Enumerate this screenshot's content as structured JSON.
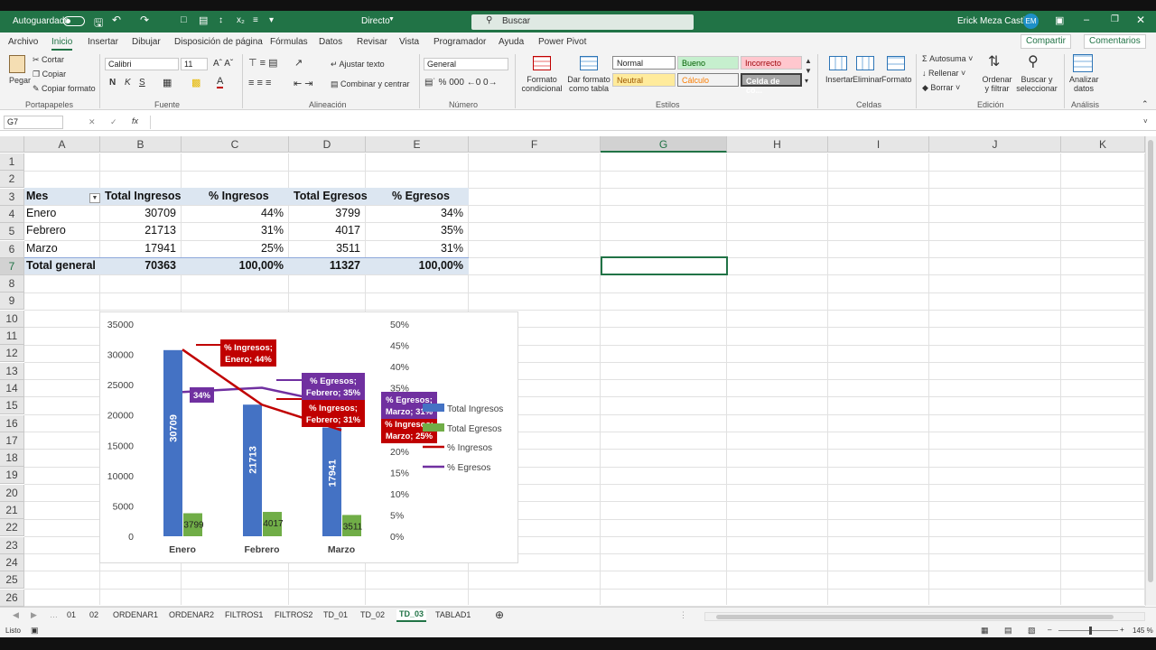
{
  "titlebar": {
    "autosave_label": "Autoguardado",
    "doc_title": "Directo",
    "search_placeholder": "Buscar",
    "user_name": "Erick Meza Castillo",
    "user_initials": "EM"
  },
  "menu": {
    "items": [
      "Archivo",
      "Inicio",
      "Insertar",
      "Dibujar",
      "Disposición de página",
      "Fórmulas",
      "Datos",
      "Revisar",
      "Vista",
      "Programador",
      "Ayuda",
      "Power Pivot"
    ],
    "share_label": "Compartir",
    "comments_label": "Comentarios"
  },
  "ribbon": {
    "clipboard": {
      "paste": "Pegar",
      "cut": "Cortar",
      "copy": "Copiar",
      "format_painter": "Copiar formato",
      "group": "Portapapeles"
    },
    "font": {
      "family": "Calibri",
      "size": "11",
      "bold": "N",
      "italic": "K",
      "underline": "S",
      "group": "Fuente"
    },
    "alignment": {
      "wrap": "Ajustar texto",
      "merge": "Combinar y centrar",
      "group": "Alineación"
    },
    "number": {
      "format": "General",
      "group": "Número"
    },
    "styles": {
      "cond_format": "Formato condicional",
      "table_format": "Dar formato como tabla",
      "normal": "Normal",
      "good": "Bueno",
      "bad": "Incorrecto",
      "neutral": "Neutral",
      "calc": "Cálculo",
      "check": "Celda de co...",
      "group": "Estilos"
    },
    "cells": {
      "insert": "Insertar",
      "delete": "Eliminar",
      "format": "Formato",
      "group": "Celdas"
    },
    "editing": {
      "autosum": "Autosuma",
      "fill": "Rellenar",
      "clear": "Borrar",
      "sort": "Ordenar y filtrar",
      "find": "Buscar y seleccionar",
      "group": "Edición"
    },
    "analysis": {
      "analyze": "Analizar datos",
      "group": "Análisis"
    }
  },
  "formula_bar": {
    "name_box": "G7",
    "fx": "fx",
    "content": ""
  },
  "columns": [
    "A",
    "B",
    "C",
    "D",
    "E",
    "F",
    "G",
    "H",
    "I",
    "J",
    "K"
  ],
  "rows": [
    "1",
    "2",
    "3",
    "4",
    "5",
    "6",
    "7",
    "8",
    "9",
    "10",
    "11",
    "12",
    "13",
    "14",
    "15",
    "16",
    "17",
    "18",
    "19",
    "20",
    "21",
    "22",
    "23",
    "24",
    "25",
    "26"
  ],
  "table": {
    "headers": [
      "Mes",
      "Total Ingresos",
      "% Ingresos",
      "Total Egresos",
      "% Egresos"
    ],
    "rows": [
      [
        "Enero",
        "30709",
        "44%",
        "3799",
        "34%"
      ],
      [
        "Febrero",
        "21713",
        "31%",
        "4017",
        "35%"
      ],
      [
        "Marzo",
        "17941",
        "25%",
        "3511",
        "31%"
      ]
    ],
    "total": [
      "Total general",
      "70363",
      "100,00%",
      "11327",
      "100,00%"
    ]
  },
  "chart_data": {
    "type": "bar",
    "categories": [
      "Enero",
      "Febrero",
      "Marzo"
    ],
    "series": [
      {
        "name": "Total Ingresos",
        "type": "bar",
        "axis": "primary",
        "color": "#4472c4",
        "values": [
          30709,
          21713,
          17941
        ]
      },
      {
        "name": "Total Egresos",
        "type": "bar",
        "axis": "primary",
        "color": "#70ad47",
        "values": [
          3799,
          4017,
          3511
        ]
      },
      {
        "name": "% Ingresos",
        "type": "line",
        "axis": "secondary",
        "color": "#c00000",
        "values": [
          44,
          31,
          25
        ]
      },
      {
        "name": "% Egresos",
        "type": "line",
        "axis": "secondary",
        "color": "#7030a0",
        "values": [
          34,
          35,
          31
        ]
      }
    ],
    "ylim": [
      0,
      35000
    ],
    "y_ticks": [
      "0",
      "5000",
      "10000",
      "15000",
      "20000",
      "25000",
      "30000",
      "35000"
    ],
    "y2lim": [
      0,
      50
    ],
    "y2_ticks": [
      "0%",
      "5%",
      "10%",
      "15%",
      "20%",
      "25%",
      "30%",
      "35%",
      "40%",
      "45%",
      "50%"
    ],
    "data_labels": {
      "ingresos_enero": [
        "% Ingresos;",
        "Enero; 44%"
      ],
      "egresos_enero": "34%",
      "egresos_febrero": [
        "% Egresos;",
        "Febrero; 35%"
      ],
      "ingresos_febrero": [
        "% Ingresos;",
        "Febrero; 31%"
      ],
      "egresos_marzo": [
        "% Egresos;",
        "Marzo; 31%"
      ],
      "ingresos_marzo": [
        "% Ingresos;",
        "Marzo; 25%"
      ]
    },
    "legend_position": "right",
    "grid": false
  },
  "sheets": {
    "tabs": [
      "01",
      "02",
      "ORDENAR1",
      "ORDENAR2",
      "FILTROS1",
      "FILTROS2",
      "TD_01",
      "TD_02",
      "TD_03",
      "TABLAD1"
    ],
    "active": "TD_03"
  },
  "status": {
    "ready": "Listo",
    "zoom": "145 %"
  }
}
